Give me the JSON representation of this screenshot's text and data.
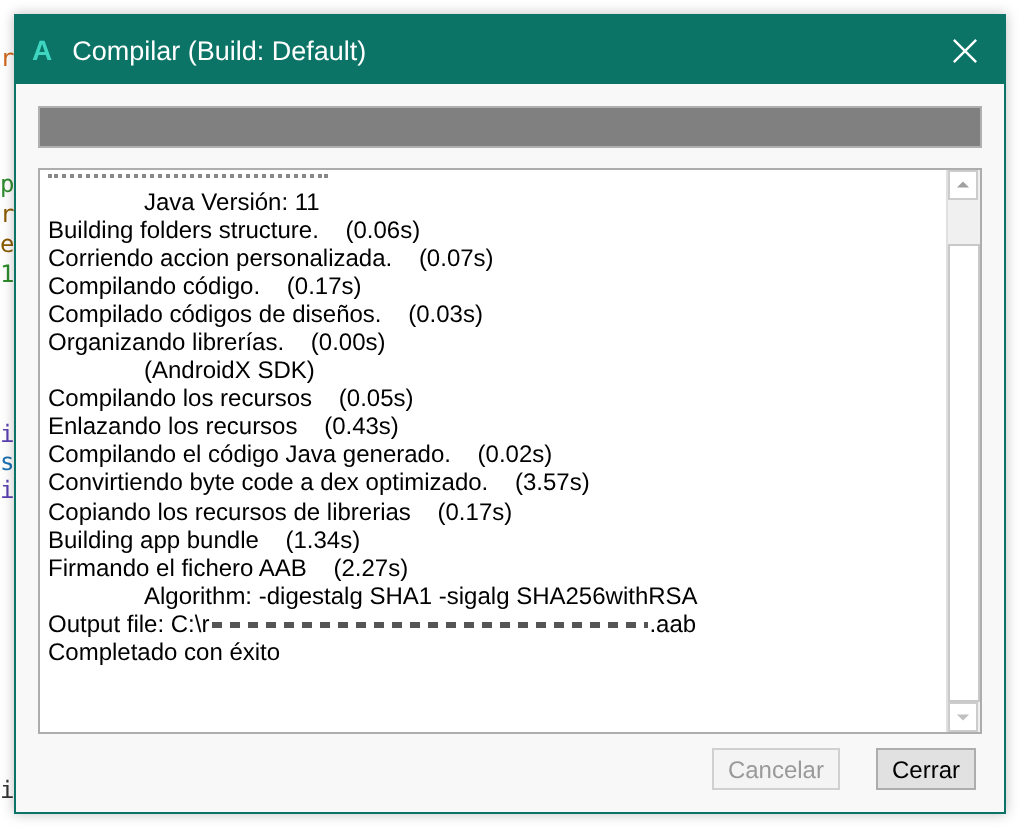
{
  "editor": {
    "margin_letters": [
      {
        "text": "r",
        "color": "#d0661c"
      },
      {
        "text": "p",
        "color": "#2e8b2e"
      },
      {
        "text": "r",
        "color": "#8a5a00"
      },
      {
        "text": "e",
        "color": "#8a5a00"
      },
      {
        "text": "1",
        "color": "#2e8b2e"
      },
      {
        "text": "i",
        "color": "#5a3fb0"
      },
      {
        "text": "s",
        "color": "#1a6fb0"
      },
      {
        "text": "i",
        "color": "#5a3fb0"
      },
      {
        "text": "i",
        "color": "#333333"
      }
    ]
  },
  "dialog": {
    "title": "Compilar (Build: Default)",
    "app_letter": "A",
    "progress": {
      "level": 1
    },
    "log": [
      {
        "kind": "detail",
        "text": "Java Versión: 11"
      },
      {
        "kind": "step",
        "text": "Building folders structure.    (0.06s)"
      },
      {
        "kind": "step",
        "text": "Corriendo accion personalizada.    (0.07s)"
      },
      {
        "kind": "step",
        "text": "Compilando código.    (0.17s)"
      },
      {
        "kind": "step",
        "text": "Compilado códigos de diseños.    (0.03s)"
      },
      {
        "kind": "step",
        "text": "Organizando librerías.    (0.00s)"
      },
      {
        "kind": "detail",
        "text": "(AndroidX SDK)"
      },
      {
        "kind": "step",
        "text": "Compilando los recursos    (0.05s)"
      },
      {
        "kind": "step",
        "text": "Enlazando los recursos    (0.43s)"
      },
      {
        "kind": "step",
        "text": "Compilando el código Java generado.    (0.02s)"
      },
      {
        "kind": "step",
        "text": "Convirtiendo byte code a dex optimizado.    (3.57s)"
      },
      {
        "kind": "step",
        "text": "Copiando los recursos de librerias    (0.17s)"
      },
      {
        "kind": "step",
        "text": "Building app bundle    (1.34s)"
      },
      {
        "kind": "step",
        "text": "Firmando el fichero AAB    (2.27s)"
      },
      {
        "kind": "detail",
        "text": "Algorithm: -digestalg SHA1 -sigalg SHA256withRSA"
      },
      {
        "kind": "redacted",
        "text": "Output file: C:\\r",
        "tail": ".aab"
      },
      {
        "kind": "step",
        "text": "Completado con éxito"
      }
    ],
    "buttons": [
      {
        "label": "Cancelar",
        "disabled": true
      },
      {
        "label": "Cerrar",
        "disabled": false
      }
    ]
  }
}
